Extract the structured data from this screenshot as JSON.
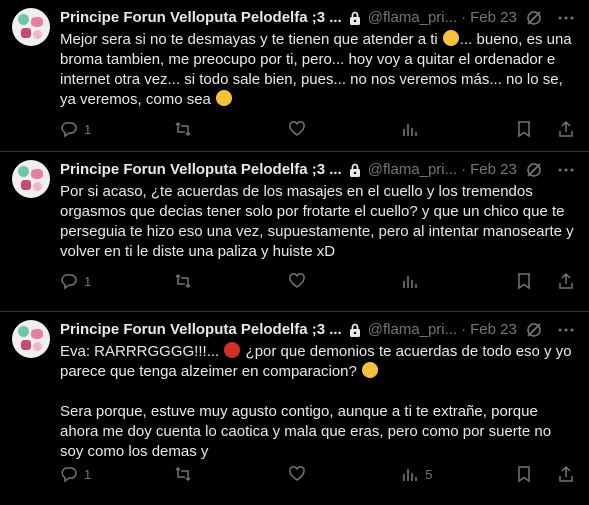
{
  "tweets": [
    {
      "author_name": "Principe Forun Velloputa Pelodelfa ;3 ...",
      "handle": "@flama_pri...",
      "date": "Feb 23",
      "text_parts": [
        "Mejor sera si no te desmayas y te tienen que atender a ti ",
        "... bueno, es una broma tambien, me preocupo por ti, pero... hoy voy a quitar el ordenador e internet otra vez... si todo sale bien, pues... no nos veremos más... no lo se, ya veremos, como sea "
      ],
      "emojis": [
        "rolling-on-floor-laughing",
        "face-blowing-kiss"
      ],
      "replies": "1",
      "retweets": "",
      "likes": "",
      "views": ""
    },
    {
      "author_name": "Principe Forun Velloputa Pelodelfa ;3 ...",
      "handle": "@flama_pri...",
      "date": "Feb 23",
      "text_parts": [
        "Por si acaso, ¿te acuerdas de los masajes en el cuello y los tremendos orgasmos que decias tener solo por frotarte el cuello? y que un chico que te perseguia te hizo eso una vez, supuestamente, pero al intentar manosearte y volver en ti le diste una paliza y huiste xD"
      ],
      "emojis": [],
      "replies": "1",
      "retweets": "",
      "likes": "",
      "views": ""
    },
    {
      "author_name": "Principe Forun Velloputa Pelodelfa ;3 ...",
      "handle": "@flama_pri...",
      "date": "Feb 23",
      "text_parts": [
        "Eva: RARRRGGGG!!!... ",
        " ¿por que demonios te acuerdas de todo eso y yo parece que tenga alzeimer en comparacion? ",
        "\n\nSera porque, estuve muy agusto contigo, aunque a ti te extrañe, porque ahora me doy cuenta lo caotica y mala que eras, pero como por suerte no soy como los demas y"
      ],
      "emojis": [
        "angry-face",
        "smiling-face"
      ],
      "replies": "1",
      "retweets": "",
      "likes": "",
      "views": "5"
    }
  ],
  "icons": {
    "lock": "lock-icon",
    "grok": "grok-icon",
    "more": "more-icon",
    "reply": "reply-icon",
    "retweet": "retweet-icon",
    "like": "like-icon",
    "views": "views-icon",
    "bookmark": "bookmark-icon",
    "share": "share-icon"
  },
  "colors": {
    "background": "#000000",
    "text": "#e7e9ea",
    "muted": "#71767b",
    "divider": "#2f3336"
  }
}
